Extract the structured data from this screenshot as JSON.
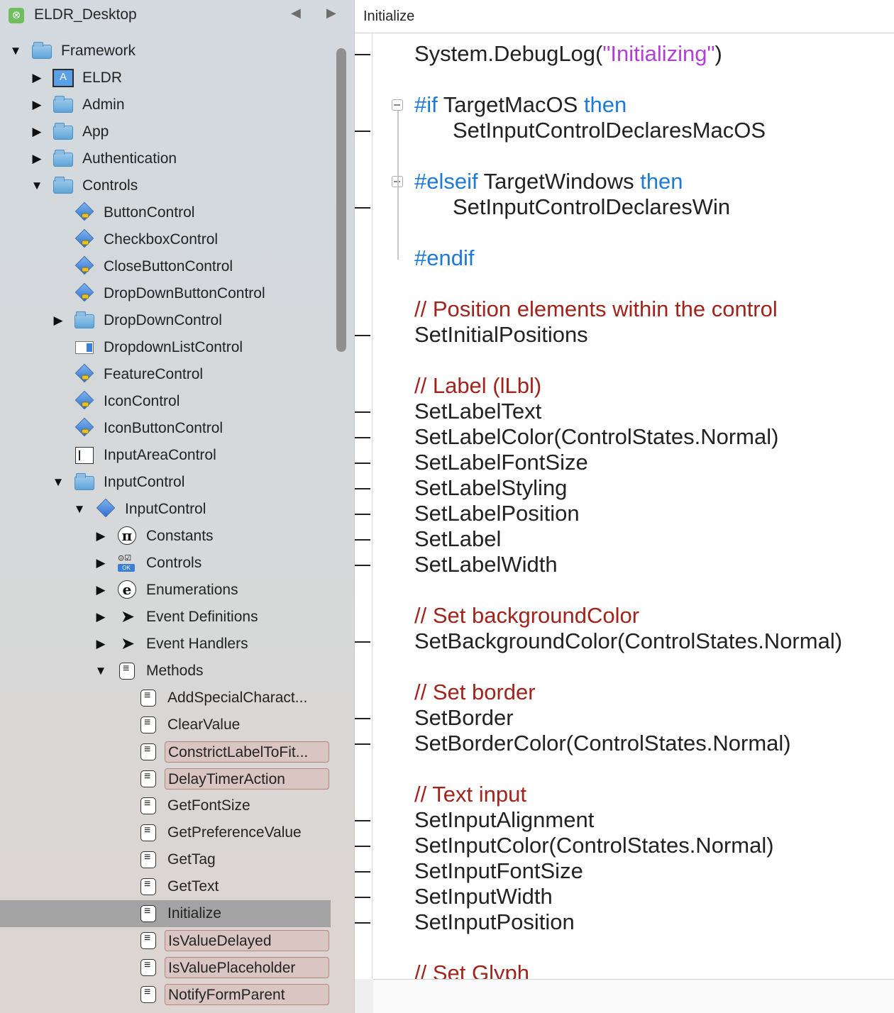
{
  "sidebar": {
    "title": "ELDR_Desktop",
    "nav_back": "◀",
    "nav_forward": "▶",
    "items": [
      {
        "label": "Framework",
        "disclosure": "▼",
        "icon": "folder-icon",
        "indent": 0,
        "flag": false,
        "selected": false
      },
      {
        "label": "ELDR",
        "disclosure": "▶",
        "icon": "app-icon",
        "indent": 1,
        "flag": false,
        "selected": false
      },
      {
        "label": "Admin",
        "disclosure": "▶",
        "icon": "folder-icon",
        "indent": 1,
        "flag": false,
        "selected": false
      },
      {
        "label": "App",
        "disclosure": "▶",
        "icon": "folder-icon",
        "indent": 1,
        "flag": false,
        "selected": false
      },
      {
        "label": "Authentication",
        "disclosure": "▶",
        "icon": "folder-icon",
        "indent": 1,
        "flag": false,
        "selected": false
      },
      {
        "label": "Controls",
        "disclosure": "▼",
        "icon": "folder-icon",
        "indent": 1,
        "flag": false,
        "selected": false
      },
      {
        "label": "ButtonControl",
        "disclosure": "",
        "icon": "class-key-icon",
        "indent": 2,
        "flag": false,
        "selected": false
      },
      {
        "label": "CheckboxControl",
        "disclosure": "",
        "icon": "class-key-icon",
        "indent": 2,
        "flag": false,
        "selected": false
      },
      {
        "label": "CloseButtonControl",
        "disclosure": "",
        "icon": "class-key-icon",
        "indent": 2,
        "flag": false,
        "selected": false
      },
      {
        "label": "DropDownButtonControl",
        "disclosure": "",
        "icon": "class-key-icon",
        "indent": 2,
        "flag": false,
        "selected": false
      },
      {
        "label": "DropDownControl",
        "disclosure": "▶",
        "icon": "folder-icon",
        "indent": 2,
        "flag": false,
        "selected": false
      },
      {
        "label": "DropdownListControl",
        "disclosure": "",
        "icon": "dropdown-list-icon",
        "indent": 2,
        "flag": false,
        "selected": false
      },
      {
        "label": "FeatureControl",
        "disclosure": "",
        "icon": "class-key-icon",
        "indent": 2,
        "flag": false,
        "selected": false
      },
      {
        "label": "IconControl",
        "disclosure": "",
        "icon": "class-key-icon",
        "indent": 2,
        "flag": false,
        "selected": false
      },
      {
        "label": "IconButtonControl",
        "disclosure": "",
        "icon": "class-key-icon",
        "indent": 2,
        "flag": false,
        "selected": false
      },
      {
        "label": "InputAreaControl",
        "disclosure": "",
        "icon": "input-area-icon",
        "indent": 2,
        "flag": false,
        "selected": false
      },
      {
        "label": "InputControl",
        "disclosure": "▼",
        "icon": "folder-icon",
        "indent": 2,
        "flag": false,
        "selected": false
      },
      {
        "label": "InputControl",
        "disclosure": "▼",
        "icon": "class-icon",
        "indent": 3,
        "flag": false,
        "selected": false
      },
      {
        "label": "Constants",
        "disclosure": "▶",
        "icon": "pi-icon",
        "indent": 4,
        "flag": false,
        "selected": false
      },
      {
        "label": "Controls",
        "disclosure": "▶",
        "icon": "controls-icon",
        "indent": 4,
        "flag": false,
        "selected": false
      },
      {
        "label": "Enumerations",
        "disclosure": "▶",
        "icon": "enum-icon",
        "indent": 4,
        "flag": false,
        "selected": false
      },
      {
        "label": "Event Definitions",
        "disclosure": "▶",
        "icon": "cursor-icon",
        "indent": 4,
        "flag": false,
        "selected": false
      },
      {
        "label": "Event Handlers",
        "disclosure": "▶",
        "icon": "cursor-icon",
        "indent": 4,
        "flag": false,
        "selected": false
      },
      {
        "label": "Methods",
        "disclosure": "▼",
        "icon": "method-icon",
        "indent": 4,
        "flag": false,
        "selected": false
      },
      {
        "label": "AddSpecialCharact...",
        "disclosure": "",
        "icon": "method-icon",
        "indent": 5,
        "flag": false,
        "selected": false
      },
      {
        "label": "ClearValue",
        "disclosure": "",
        "icon": "method-icon",
        "indent": 5,
        "flag": false,
        "selected": false
      },
      {
        "label": "ConstrictLabelToFit...",
        "disclosure": "",
        "icon": "method-icon",
        "indent": 5,
        "flag": true,
        "selected": false
      },
      {
        "label": "DelayTimerAction",
        "disclosure": "",
        "icon": "method-icon",
        "indent": 5,
        "flag": true,
        "selected": false
      },
      {
        "label": "GetFontSize",
        "disclosure": "",
        "icon": "method-icon",
        "indent": 5,
        "flag": false,
        "selected": false
      },
      {
        "label": "GetPreferenceValue",
        "disclosure": "",
        "icon": "method-icon",
        "indent": 5,
        "flag": false,
        "selected": false
      },
      {
        "label": "GetTag",
        "disclosure": "",
        "icon": "method-icon",
        "indent": 5,
        "flag": false,
        "selected": false
      },
      {
        "label": "GetText",
        "disclosure": "",
        "icon": "method-icon",
        "indent": 5,
        "flag": false,
        "selected": false
      },
      {
        "label": "Initialize",
        "disclosure": "",
        "icon": "method-icon",
        "indent": 5,
        "flag": false,
        "selected": true
      },
      {
        "label": "IsValueDelayed",
        "disclosure": "",
        "icon": "method-icon",
        "indent": 5,
        "flag": true,
        "selected": false
      },
      {
        "label": "IsValuePlaceholder",
        "disclosure": "",
        "icon": "method-icon",
        "indent": 5,
        "flag": true,
        "selected": false
      },
      {
        "label": "NotifyFormParent",
        "disclosure": "",
        "icon": "method-icon",
        "indent": 5,
        "flag": true,
        "selected": false
      }
    ]
  },
  "editor": {
    "tab_title": "Initialize",
    "lines": [
      {
        "parts": [
          {
            "t": "System.DebugLog(",
            "c": "plain"
          },
          {
            "t": "\"Initializing\"",
            "c": "str"
          },
          {
            "t": ")",
            "c": "plain"
          }
        ],
        "indent": 0,
        "tick": true
      },
      {
        "parts": [
          {
            "t": "#if",
            "c": "kw"
          },
          {
            "t": " TargetMacOS ",
            "c": "plain"
          },
          {
            "t": "then",
            "c": "kw"
          }
        ],
        "indent": 0,
        "tick": false,
        "fold": true
      },
      {
        "parts": [
          {
            "t": "SetInputControlDeclaresMacOS",
            "c": "plain"
          }
        ],
        "indent": 1,
        "tick": true
      },
      {
        "parts": [
          {
            "t": "#elseif",
            "c": "kw"
          },
          {
            "t": " TargetWindows ",
            "c": "plain"
          },
          {
            "t": "then",
            "c": "kw"
          }
        ],
        "indent": 0,
        "tick": false,
        "fold": true
      },
      {
        "parts": [
          {
            "t": "SetInputControlDeclaresWin",
            "c": "plain"
          }
        ],
        "indent": 1,
        "tick": true
      },
      {
        "parts": [
          {
            "t": "#endif",
            "c": "kw"
          }
        ],
        "indent": 0,
        "tick": false
      },
      {
        "parts": [
          {
            "t": "// Position elements within the control",
            "c": "cm"
          }
        ],
        "indent": 0,
        "tick": false
      },
      {
        "parts": [
          {
            "t": "SetInitialPositions",
            "c": "plain"
          }
        ],
        "indent": 0,
        "tick": true
      },
      {
        "parts": [
          {
            "t": "// Label (lLbl)",
            "c": "cm"
          }
        ],
        "indent": 0,
        "tick": false
      },
      {
        "parts": [
          {
            "t": "SetLabelText",
            "c": "plain"
          }
        ],
        "indent": 0,
        "tick": true
      },
      {
        "parts": [
          {
            "t": "SetLabelColor(ControlStates.Normal)",
            "c": "plain"
          }
        ],
        "indent": 0,
        "tick": true
      },
      {
        "parts": [
          {
            "t": "SetLabelFontSize",
            "c": "plain"
          }
        ],
        "indent": 0,
        "tick": true
      },
      {
        "parts": [
          {
            "t": "SetLabelStyling",
            "c": "plain"
          }
        ],
        "indent": 0,
        "tick": true
      },
      {
        "parts": [
          {
            "t": "SetLabelPosition",
            "c": "plain"
          }
        ],
        "indent": 0,
        "tick": true
      },
      {
        "parts": [
          {
            "t": "SetLabel",
            "c": "plain"
          }
        ],
        "indent": 0,
        "tick": true
      },
      {
        "parts": [
          {
            "t": "SetLabelWidth",
            "c": "plain"
          }
        ],
        "indent": 0,
        "tick": true
      },
      {
        "parts": [
          {
            "t": "// Set backgroundColor",
            "c": "cm"
          }
        ],
        "indent": 0,
        "tick": false
      },
      {
        "parts": [
          {
            "t": "SetBackgroundColor(ControlStates.Normal)",
            "c": "plain"
          }
        ],
        "indent": 0,
        "tick": true
      },
      {
        "parts": [
          {
            "t": "// Set border",
            "c": "cm"
          }
        ],
        "indent": 0,
        "tick": false
      },
      {
        "parts": [
          {
            "t": "SetBorder",
            "c": "plain"
          }
        ],
        "indent": 0,
        "tick": true
      },
      {
        "parts": [
          {
            "t": "SetBorderColor(ControlStates.Normal)",
            "c": "plain"
          }
        ],
        "indent": 0,
        "tick": true
      },
      {
        "parts": [
          {
            "t": "// Text input",
            "c": "cm"
          }
        ],
        "indent": 0,
        "tick": false
      },
      {
        "parts": [
          {
            "t": "SetInputAlignment",
            "c": "plain"
          }
        ],
        "indent": 0,
        "tick": true
      },
      {
        "parts": [
          {
            "t": "SetInputColor(ControlStates.Normal)",
            "c": "plain"
          }
        ],
        "indent": 0,
        "tick": true
      },
      {
        "parts": [
          {
            "t": "SetInputFontSize",
            "c": "plain"
          }
        ],
        "indent": 0,
        "tick": true
      },
      {
        "parts": [
          {
            "t": "SetInputWidth",
            "c": "plain"
          }
        ],
        "indent": 0,
        "tick": true
      },
      {
        "parts": [
          {
            "t": "SetInputPosition",
            "c": "plain"
          }
        ],
        "indent": 0,
        "tick": true
      },
      {
        "parts": [
          {
            "t": "// Set Glyph",
            "c": "cm"
          }
        ],
        "indent": 0,
        "tick": false
      }
    ]
  },
  "colors": {
    "keyword": "#1d7ad6",
    "comment": "#a0241c",
    "string": "#b23fd4",
    "selection": "#a3a3a3",
    "flag_bg": "#d9c6c2",
    "flag_border": "#b9847d"
  }
}
